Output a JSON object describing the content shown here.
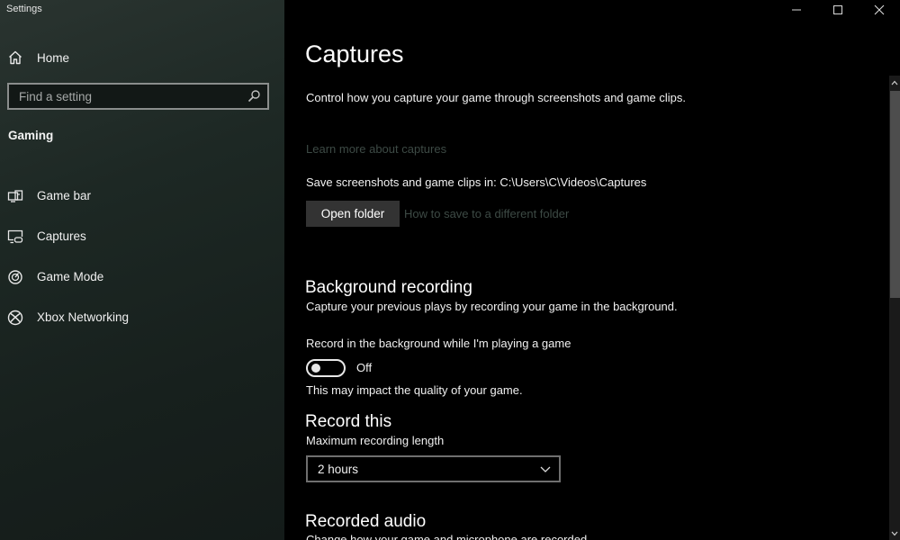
{
  "window": {
    "title": "Settings",
    "controls": [
      {
        "name": "minimize",
        "icon": "minimize-icon"
      },
      {
        "name": "maximize",
        "icon": "maximize-icon"
      },
      {
        "name": "close",
        "icon": "close-icon"
      }
    ]
  },
  "sidebar": {
    "home": {
      "label": "Home",
      "icon": "home-icon"
    },
    "search": {
      "placeholder": "Find a setting",
      "value": "",
      "icon": "search-icon"
    },
    "group_label": "Gaming",
    "items": [
      {
        "label": "Game bar",
        "icon": "game-bar-icon"
      },
      {
        "label": "Captures",
        "icon": "captures-icon",
        "selected": true
      },
      {
        "label": "Game Mode",
        "icon": "game-mode-icon"
      },
      {
        "label": "Xbox Networking",
        "icon": "xbox-icon"
      }
    ]
  },
  "main": {
    "title": "Captures",
    "description": "Control how you capture your game through screenshots and game clips.",
    "learn_more_link": "Learn more about captures",
    "save_location": "Save screenshots and game clips in: C:\\Users\\C\\Videos\\Captures",
    "open_folder_button": "Open folder",
    "how_to_link": "How to save to a different folder",
    "background_recording": {
      "heading": "Background recording",
      "description": "Capture your previous plays by recording your game in the background.",
      "toggle_label": "Record in the background while I'm playing a game",
      "toggle_state": "Off",
      "toggle_on": false,
      "note": "This may impact the quality of your game."
    },
    "record_this": {
      "heading": "Record this",
      "max_length_label": "Maximum recording length",
      "max_length_value": "2 hours"
    },
    "recorded_audio": {
      "heading": "Recorded audio",
      "description": "Change how your game and microphone are recorded."
    }
  },
  "colors": {
    "link": "#3d4a45",
    "button_bg": "#333333",
    "sidebar_bg": "#1d2824"
  }
}
